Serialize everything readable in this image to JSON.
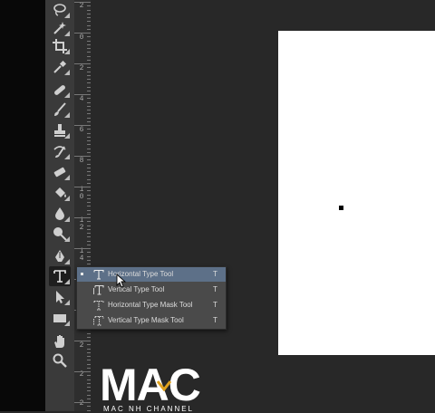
{
  "toolbar": {
    "tools": [
      {
        "name": "lasso-tool",
        "icon": "lasso-icon"
      },
      {
        "name": "quick-selection-tool",
        "icon": "magic-wand-icon"
      },
      {
        "name": "crop-tool",
        "icon": "crop-icon"
      },
      {
        "name": "eyedropper-tool",
        "icon": "eyedropper-icon"
      },
      {
        "name": "spot-healing-tool",
        "icon": "bandage-icon"
      },
      {
        "name": "brush-tool",
        "icon": "brush-icon"
      },
      {
        "name": "clone-stamp-tool",
        "icon": "stamp-icon"
      },
      {
        "name": "history-brush-tool",
        "icon": "history-brush-icon"
      },
      {
        "name": "eraser-tool",
        "icon": "eraser-icon"
      },
      {
        "name": "paint-bucket-tool",
        "icon": "paint-bucket-icon"
      },
      {
        "name": "blur-tool",
        "icon": "drop-icon"
      },
      {
        "name": "dodge-tool",
        "icon": "dodge-icon"
      },
      {
        "name": "pen-tool",
        "icon": "pen-icon"
      },
      {
        "name": "type-tool",
        "icon": "type-icon",
        "active": true
      },
      {
        "name": "path-selection-tool",
        "icon": "arrow-icon"
      },
      {
        "name": "rectangle-tool",
        "icon": "rectangle-icon"
      },
      {
        "name": "hand-tool",
        "icon": "hand-icon"
      },
      {
        "name": "zoom-tool",
        "icon": "magnifier-icon"
      }
    ]
  },
  "ruler": {
    "labels": [
      "2",
      "0",
      "2",
      "4",
      "6",
      "8",
      "1\n0",
      "1\n2",
      "1\n4",
      "2",
      "2",
      "2"
    ]
  },
  "type_flyout": {
    "items": [
      {
        "label": "Horizontal Type Tool",
        "shortcut": "T",
        "icon": "horizontal-type-icon",
        "selected": true
      },
      {
        "label": "Vertical Type Tool",
        "shortcut": "T",
        "icon": "vertical-type-icon",
        "selected": false
      },
      {
        "label": "Horizontal Type Mask Tool",
        "shortcut": "T",
        "icon": "horizontal-type-mask-icon",
        "selected": false
      },
      {
        "label": "Vertical Type Mask Tool",
        "shortcut": "T",
        "icon": "vertical-type-mask-icon",
        "selected": false
      }
    ]
  },
  "colors": {
    "foreground": "#000000",
    "background": "#ffffff",
    "selection": "#5d7088",
    "panel": "#3a3a3a",
    "workspace": "#282828"
  },
  "watermark": {
    "word": "MAC",
    "subtitle": "MAC NH CHANNEL"
  }
}
